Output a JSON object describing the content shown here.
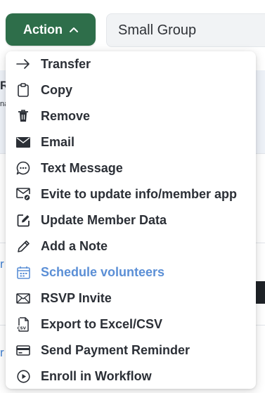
{
  "header": {
    "action_label": "Action",
    "group_value": "Small Group"
  },
  "background": {
    "fragments": [
      "R",
      "na",
      "r",
      "r"
    ]
  },
  "menu": {
    "items": [
      {
        "label": "Transfer",
        "icon": "arrow-right-icon"
      },
      {
        "label": "Copy",
        "icon": "clipboard-icon"
      },
      {
        "label": "Remove",
        "icon": "trash-icon"
      },
      {
        "label": "Email",
        "icon": "envelope-icon"
      },
      {
        "label": "Text Message",
        "icon": "chat-bubble-icon"
      },
      {
        "label": "Evite to update info/member app",
        "icon": "envelope-edit-icon"
      },
      {
        "label": "Update Member Data",
        "icon": "edit-square-icon"
      },
      {
        "label": "Add a Note",
        "icon": "pencil-icon"
      },
      {
        "label": "Schedule volunteers",
        "icon": "calendar-icon",
        "highlight_color": "#5b8fd6"
      },
      {
        "label": "RSVP Invite",
        "icon": "envelope-outline-icon"
      },
      {
        "label": "Export to Excel/CSV",
        "icon": "csv-file-icon"
      },
      {
        "label": "Send Payment Reminder",
        "icon": "credit-card-icon"
      },
      {
        "label": "Enroll in Workflow",
        "icon": "play-circle-icon"
      }
    ]
  },
  "colors": {
    "action_button": "#2e6e4a",
    "highlight": "#5b8fd6",
    "text": "#2b2f36"
  }
}
